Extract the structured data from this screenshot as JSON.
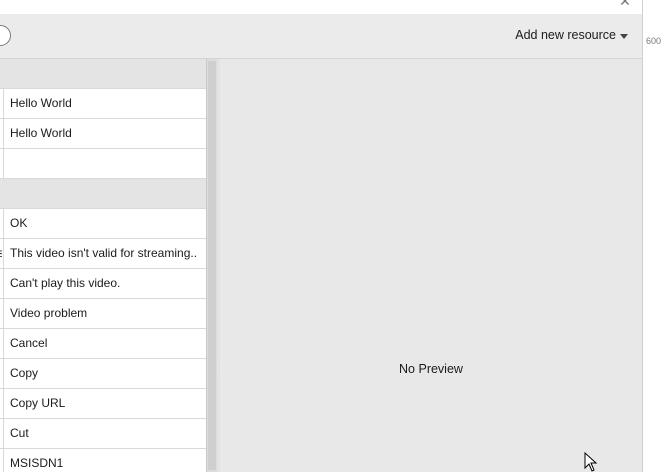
{
  "window": {
    "close_glyph": "✕"
  },
  "toolbar": {
    "add_resource_label": "Add new resource"
  },
  "ruler": {
    "tick_label": "600"
  },
  "table": {
    "rows": [
      {
        "kind": "header",
        "text": ""
      },
      {
        "kind": "row",
        "text": "Hello World",
        "clip": ""
      },
      {
        "kind": "row",
        "text": "Hello World",
        "clip": ""
      },
      {
        "kind": "row",
        "text": "",
        "clip": ""
      },
      {
        "kind": "header",
        "text": ""
      },
      {
        "kind": "row",
        "text": "OK",
        "clip": ""
      },
      {
        "kind": "row",
        "text": "This video isn't valid for streaming...",
        "clip": "s"
      },
      {
        "kind": "row",
        "text": "Can't play this video.",
        "clip": ""
      },
      {
        "kind": "row",
        "text": "Video problem",
        "clip": ""
      },
      {
        "kind": "row",
        "text": "Cancel",
        "clip": ""
      },
      {
        "kind": "row",
        "text": "Copy",
        "clip": ""
      },
      {
        "kind": "row",
        "text": "Copy URL",
        "clip": ""
      },
      {
        "kind": "row",
        "text": "Cut",
        "clip": ""
      },
      {
        "kind": "row",
        "text": "MSISDN1",
        "clip": ""
      }
    ]
  },
  "preview": {
    "empty_text": "No Preview"
  }
}
